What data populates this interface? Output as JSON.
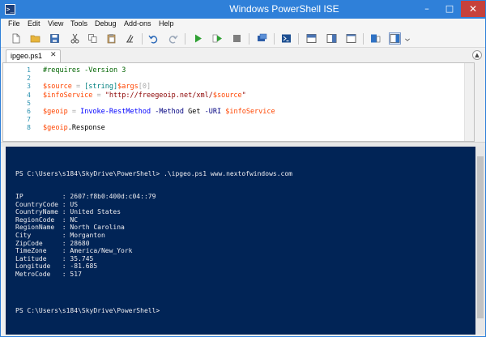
{
  "window": {
    "title": "Windows PowerShell ISE",
    "app_icon_glyph": ">_"
  },
  "window_controls": {
    "minimize": "–",
    "maximize": "□",
    "close": "✕"
  },
  "menu": [
    "File",
    "Edit",
    "View",
    "Tools",
    "Debug",
    "Add-ons",
    "Help"
  ],
  "tab": {
    "label": "ipgeo.ps1",
    "close": "✕"
  },
  "editor": {
    "line_numbers": [
      "1",
      "2",
      "3",
      "4",
      "5",
      "6",
      "7",
      "8"
    ],
    "lines": [
      [
        {
          "t": "#requires -Version 3",
          "c": "comment"
        }
      ],
      [],
      [
        {
          "t": "$source",
          "c": "var"
        },
        {
          "t": " = ",
          "c": "op"
        },
        {
          "t": "[string]",
          "c": "type"
        },
        {
          "t": "$args",
          "c": "var"
        },
        {
          "t": "[0]",
          "c": "op"
        }
      ],
      [
        {
          "t": "$infoService",
          "c": "var"
        },
        {
          "t": " = ",
          "c": "op"
        },
        {
          "t": "\"http://freegeoip.net/xml/",
          "c": "str"
        },
        {
          "t": "$source",
          "c": "var"
        },
        {
          "t": "\"",
          "c": "str"
        }
      ],
      [],
      [
        {
          "t": "$geoip",
          "c": "var"
        },
        {
          "t": " = ",
          "c": "op"
        },
        {
          "t": "Invoke-RestMethod",
          "c": "cmd"
        },
        {
          "t": " -Method",
          "c": "param"
        },
        {
          "t": " Get",
          "c": "plain"
        },
        {
          "t": " -URI",
          "c": "param"
        },
        {
          "t": " ",
          "c": "plain"
        },
        {
          "t": "$infoService",
          "c": "var"
        }
      ],
      [],
      [
        {
          "t": "$geoip",
          "c": "var"
        },
        {
          "t": ".Response",
          "c": "plain"
        }
      ]
    ]
  },
  "console": {
    "command_line": "PS C:\\Users\\s184\\SkyDrive\\PowerShell> .\\ipgeo.ps1 www.nextofwindows.com",
    "output": [
      "IP          : 2607:f8b0:400d:c04::79",
      "CountryCode : US",
      "CountryName : United States",
      "RegionCode  : NC",
      "RegionName  : North Carolina",
      "City        : Morganton",
      "ZipCode     : 28680",
      "TimeZone    : America/New_York",
      "Latitude    : 35.745",
      "Longitude   : -81.685",
      "MetroCode   : 517"
    ],
    "prompt": "PS C:\\Users\\s184\\SkyDrive\\PowerShell>"
  },
  "colors": {
    "title_bar": "#2f80d9",
    "console_bg": "#012456",
    "console_text": "#eeedf0",
    "close_button": "#c6413b"
  }
}
